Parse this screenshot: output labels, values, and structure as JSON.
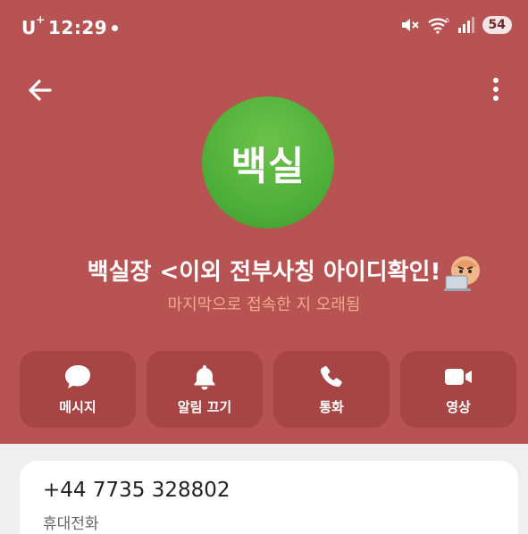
{
  "status_bar": {
    "carrier": "U",
    "carrier_plus": "+",
    "time": "12:29",
    "battery": "54"
  },
  "profile": {
    "avatar_text": "백실",
    "name": "백실장 <이외 전부사칭 아이디확인!",
    "last_seen": "마지막으로 접속한 지 오래됨"
  },
  "actions": [
    {
      "label": "메시지",
      "icon": "message-icon"
    },
    {
      "label": "알림 끄기",
      "icon": "bell-icon"
    },
    {
      "label": "통화",
      "icon": "phone-icon"
    },
    {
      "label": "영상",
      "icon": "video-icon"
    }
  ],
  "phone": {
    "number": "+44 7735 328802",
    "type": "휴대전화"
  },
  "colors": {
    "header_bg": "#b75352",
    "action_bg": "#a64544",
    "avatar_green": "#4fb039",
    "last_seen_text": "#f3a98e"
  }
}
